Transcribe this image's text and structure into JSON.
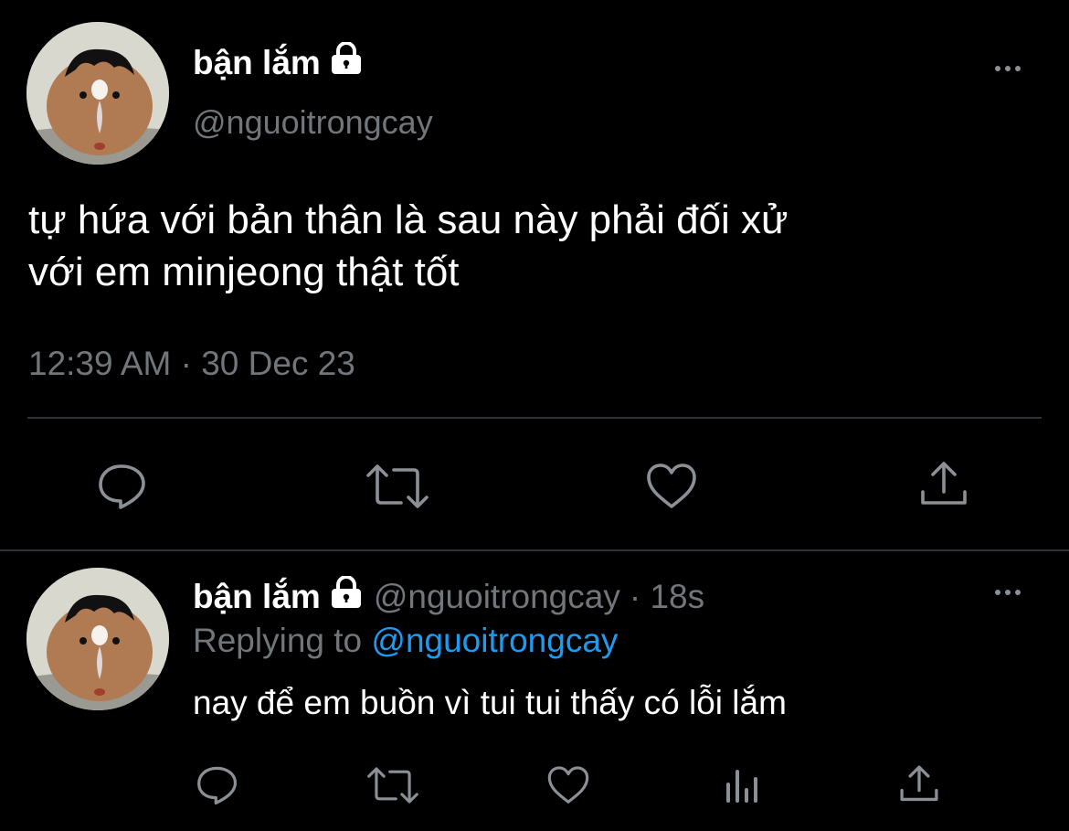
{
  "main_tweet": {
    "display_name": "bận lắm",
    "handle": "@nguoitrongcay",
    "text_line1": "tự hứa với bản thân là sau này phải đối xử",
    "text_line2": "với em minjeong thật tốt",
    "timestamp": "12:39 AM · 30 Dec 23",
    "actions": [
      "reply-icon",
      "retweet-icon",
      "like-icon",
      "share-icon"
    ]
  },
  "reply_tweet": {
    "display_name": "bận lắm",
    "handle": "@nguoitrongcay",
    "age": "· 18s",
    "replying_prefix": "Replying to",
    "replying_handle": "@nguoitrongcay",
    "text": "nay để em buồn vì tui tui thấy có lỗi lắm",
    "actions": [
      "reply-icon",
      "retweet-icon",
      "like-icon",
      "analytics-icon",
      "share-icon"
    ]
  },
  "colors": {
    "background": "#000000",
    "text": "#e7e9ea",
    "secondary": "#71767b",
    "link": "#1d9bf0",
    "divider": "#2f3336"
  }
}
